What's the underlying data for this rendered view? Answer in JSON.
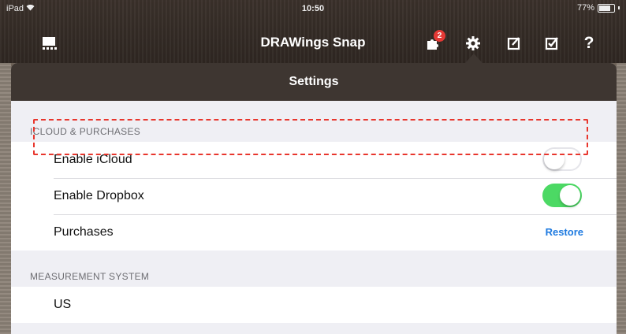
{
  "status_bar": {
    "carrier": "iPad",
    "wifi_icon": "wifi-icon",
    "time": "10:50",
    "battery": "77%"
  },
  "navbar": {
    "title": "DRAWings Snap",
    "notification_count": "2",
    "icons": [
      "gallery-icon",
      "puzzle-icon",
      "gear-icon",
      "edit-icon",
      "checkbox-edit-icon",
      "help-icon"
    ]
  },
  "settings": {
    "title": "Settings",
    "sections": [
      {
        "header": "ICLOUD & PURCHASES",
        "rows": [
          {
            "label": "Enable iCloud",
            "toggle": "off"
          },
          {
            "label": "Enable Dropbox",
            "toggle": "on"
          },
          {
            "label": "Purchases",
            "action": "Restore"
          }
        ]
      },
      {
        "header": "MEASUREMENT SYSTEM",
        "rows": [
          {
            "label": "US"
          }
        ]
      }
    ]
  },
  "colors": {
    "toggle_on": "#4cd964",
    "highlight": "#e8362d",
    "link": "#1e7ae0",
    "header_bg": "#3e3631"
  }
}
